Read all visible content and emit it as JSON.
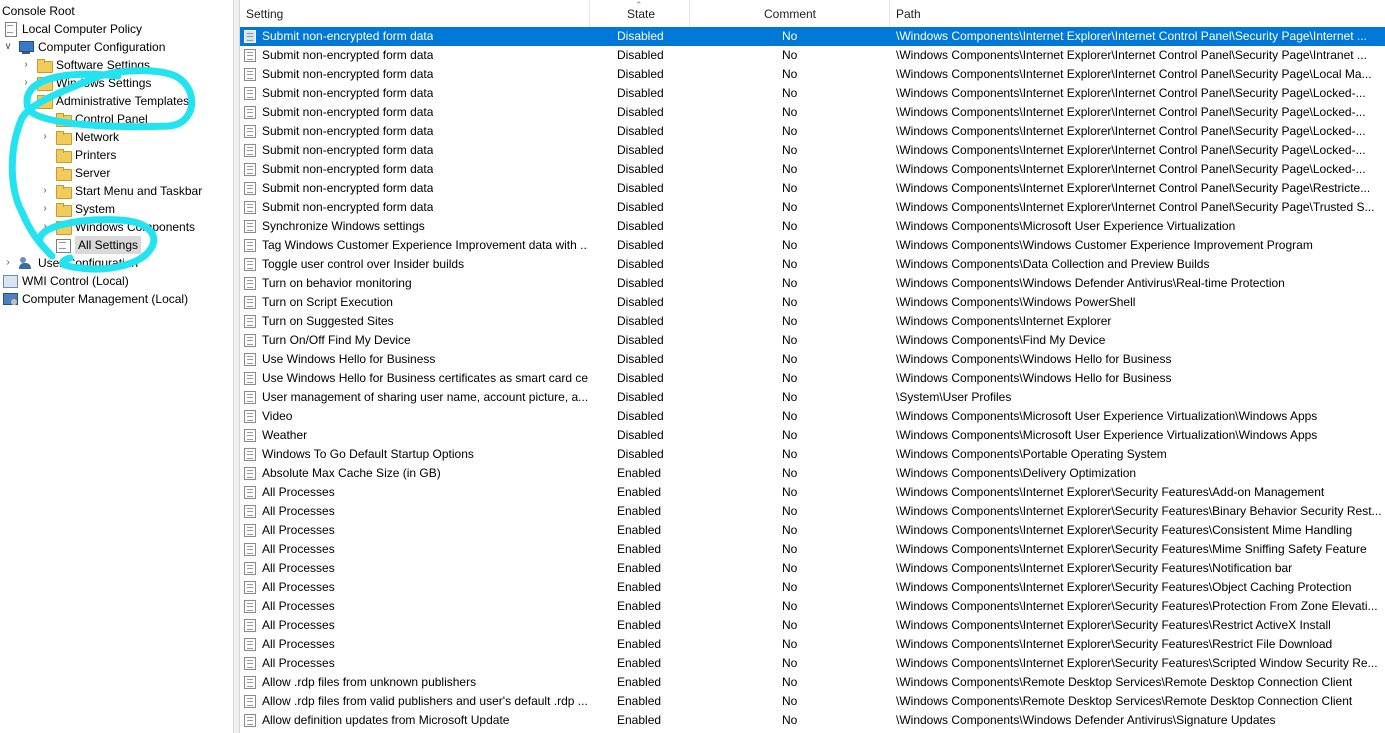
{
  "tree": {
    "console_root": "Console Root",
    "local_policy": "Local Computer Policy",
    "computer_config": "Computer Configuration",
    "software_settings": "Software Settings",
    "windows_settings": "Windows Settings",
    "admin_templates": "Administrative Templates",
    "control_panel": "Control Panel",
    "network": "Network",
    "printers": "Printers",
    "server": "Server",
    "start_menu": "Start Menu and Taskbar",
    "system": "System",
    "windows_components": "Windows Components",
    "all_settings": "All Settings",
    "user_config": "User Configuration",
    "wmi_control": "WMI Control (Local)",
    "comp_mgmt": "Computer Management (Local)"
  },
  "annotation_color": "#22e3ef",
  "selection_color": "#0078d7",
  "columns": {
    "setting": "Setting",
    "state": "State",
    "comment": "Comment",
    "path": "Path"
  },
  "rows": [
    {
      "setting": "Submit non-encrypted form data",
      "state": "Disabled",
      "comment": "No",
      "path": "\\Windows Components\\Internet Explorer\\Internet Control Panel\\Security Page\\Internet ...",
      "selected": true
    },
    {
      "setting": "Submit non-encrypted form data",
      "state": "Disabled",
      "comment": "No",
      "path": "\\Windows Components\\Internet Explorer\\Internet Control Panel\\Security Page\\Intranet ..."
    },
    {
      "setting": "Submit non-encrypted form data",
      "state": "Disabled",
      "comment": "No",
      "path": "\\Windows Components\\Internet Explorer\\Internet Control Panel\\Security Page\\Local Ma..."
    },
    {
      "setting": "Submit non-encrypted form data",
      "state": "Disabled",
      "comment": "No",
      "path": "\\Windows Components\\Internet Explorer\\Internet Control Panel\\Security Page\\Locked-..."
    },
    {
      "setting": "Submit non-encrypted form data",
      "state": "Disabled",
      "comment": "No",
      "path": "\\Windows Components\\Internet Explorer\\Internet Control Panel\\Security Page\\Locked-..."
    },
    {
      "setting": "Submit non-encrypted form data",
      "state": "Disabled",
      "comment": "No",
      "path": "\\Windows Components\\Internet Explorer\\Internet Control Panel\\Security Page\\Locked-..."
    },
    {
      "setting": "Submit non-encrypted form data",
      "state": "Disabled",
      "comment": "No",
      "path": "\\Windows Components\\Internet Explorer\\Internet Control Panel\\Security Page\\Locked-..."
    },
    {
      "setting": "Submit non-encrypted form data",
      "state": "Disabled",
      "comment": "No",
      "path": "\\Windows Components\\Internet Explorer\\Internet Control Panel\\Security Page\\Locked-..."
    },
    {
      "setting": "Submit non-encrypted form data",
      "state": "Disabled",
      "comment": "No",
      "path": "\\Windows Components\\Internet Explorer\\Internet Control Panel\\Security Page\\Restricte..."
    },
    {
      "setting": "Submit non-encrypted form data",
      "state": "Disabled",
      "comment": "No",
      "path": "\\Windows Components\\Internet Explorer\\Internet Control Panel\\Security Page\\Trusted S..."
    },
    {
      "setting": "Synchronize Windows settings",
      "state": "Disabled",
      "comment": "No",
      "path": "\\Windows Components\\Microsoft User Experience Virtualization"
    },
    {
      "setting": "Tag Windows Customer Experience Improvement data with ...",
      "state": "Disabled",
      "comment": "No",
      "path": "\\Windows Components\\Windows Customer Experience Improvement Program"
    },
    {
      "setting": "Toggle user control over Insider builds",
      "state": "Disabled",
      "comment": "No",
      "path": "\\Windows Components\\Data Collection and Preview Builds"
    },
    {
      "setting": "Turn on behavior monitoring",
      "state": "Disabled",
      "comment": "No",
      "path": "\\Windows Components\\Windows Defender Antivirus\\Real-time Protection"
    },
    {
      "setting": "Turn on Script Execution",
      "state": "Disabled",
      "comment": "No",
      "path": "\\Windows Components\\Windows PowerShell"
    },
    {
      "setting": "Turn on Suggested Sites",
      "state": "Disabled",
      "comment": "No",
      "path": "\\Windows Components\\Internet Explorer"
    },
    {
      "setting": "Turn On/Off Find My Device",
      "state": "Disabled",
      "comment": "No",
      "path": "\\Windows Components\\Find My Device"
    },
    {
      "setting": "Use Windows Hello for Business",
      "state": "Disabled",
      "comment": "No",
      "path": "\\Windows Components\\Windows Hello for Business"
    },
    {
      "setting": "Use Windows Hello for Business certificates as smart card ce...",
      "state": "Disabled",
      "comment": "No",
      "path": "\\Windows Components\\Windows Hello for Business"
    },
    {
      "setting": "User management of sharing user name, account picture, a...",
      "state": "Disabled",
      "comment": "No",
      "path": "\\System\\User Profiles"
    },
    {
      "setting": "Video",
      "state": "Disabled",
      "comment": "No",
      "path": "\\Windows Components\\Microsoft User Experience Virtualization\\Windows Apps"
    },
    {
      "setting": "Weather",
      "state": "Disabled",
      "comment": "No",
      "path": "\\Windows Components\\Microsoft User Experience Virtualization\\Windows Apps"
    },
    {
      "setting": "Windows To Go Default Startup Options",
      "state": "Disabled",
      "comment": "No",
      "path": "\\Windows Components\\Portable Operating System"
    },
    {
      "setting": "Absolute Max Cache Size (in GB)",
      "state": "Enabled",
      "comment": "No",
      "path": "\\Windows Components\\Delivery Optimization"
    },
    {
      "setting": "All Processes",
      "state": "Enabled",
      "comment": "No",
      "path": "\\Windows Components\\Internet Explorer\\Security Features\\Add-on Management"
    },
    {
      "setting": "All Processes",
      "state": "Enabled",
      "comment": "No",
      "path": "\\Windows Components\\Internet Explorer\\Security Features\\Binary Behavior Security Rest..."
    },
    {
      "setting": "All Processes",
      "state": "Enabled",
      "comment": "No",
      "path": "\\Windows Components\\Internet Explorer\\Security Features\\Consistent Mime Handling"
    },
    {
      "setting": "All Processes",
      "state": "Enabled",
      "comment": "No",
      "path": "\\Windows Components\\Internet Explorer\\Security Features\\Mime Sniffing Safety Feature"
    },
    {
      "setting": "All Processes",
      "state": "Enabled",
      "comment": "No",
      "path": "\\Windows Components\\Internet Explorer\\Security Features\\Notification bar"
    },
    {
      "setting": "All Processes",
      "state": "Enabled",
      "comment": "No",
      "path": "\\Windows Components\\Internet Explorer\\Security Features\\Object Caching Protection"
    },
    {
      "setting": "All Processes",
      "state": "Enabled",
      "comment": "No",
      "path": "\\Windows Components\\Internet Explorer\\Security Features\\Protection From Zone Elevati..."
    },
    {
      "setting": "All Processes",
      "state": "Enabled",
      "comment": "No",
      "path": "\\Windows Components\\Internet Explorer\\Security Features\\Restrict ActiveX Install"
    },
    {
      "setting": "All Processes",
      "state": "Enabled",
      "comment": "No",
      "path": "\\Windows Components\\Internet Explorer\\Security Features\\Restrict File Download"
    },
    {
      "setting": "All Processes",
      "state": "Enabled",
      "comment": "No",
      "path": "\\Windows Components\\Internet Explorer\\Security Features\\Scripted Window Security Re..."
    },
    {
      "setting": "Allow .rdp files from unknown publishers",
      "state": "Enabled",
      "comment": "No",
      "path": "\\Windows Components\\Remote Desktop Services\\Remote Desktop Connection Client"
    },
    {
      "setting": "Allow .rdp files from valid publishers and user's default .rdp ...",
      "state": "Enabled",
      "comment": "No",
      "path": "\\Windows Components\\Remote Desktop Services\\Remote Desktop Connection Client"
    },
    {
      "setting": "Allow definition updates from Microsoft Update",
      "state": "Enabled",
      "comment": "No",
      "path": "\\Windows Components\\Windows Defender Antivirus\\Signature Updates"
    }
  ]
}
